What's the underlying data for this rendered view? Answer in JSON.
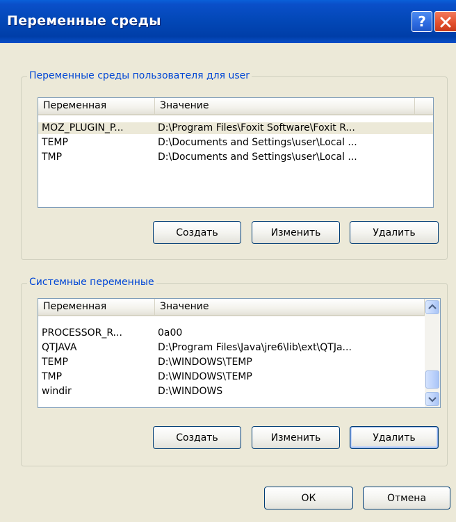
{
  "window": {
    "title": "Переменные среды"
  },
  "title_buttons": {
    "help_label": "?"
  },
  "user_group": {
    "legend": "Переменные среды пользователя для user",
    "columns": [
      "Переменная",
      "Значение"
    ],
    "rows": [
      {
        "name": "MOZ_PLUGIN_P...",
        "value": "D:\\Program Files\\Foxit Software\\Foxit R..."
      },
      {
        "name": "TEMP",
        "value": "D:\\Documents and Settings\\user\\Local ..."
      },
      {
        "name": "TMP",
        "value": "D:\\Documents and Settings\\user\\Local ..."
      }
    ],
    "buttons": {
      "new": "Создать",
      "edit": "Изменить",
      "delete": "Удалить"
    }
  },
  "system_group": {
    "legend": "Системные переменные",
    "columns": [
      "Переменная",
      "Значение"
    ],
    "rows": [
      {
        "name": "PROCESSOR_R...",
        "value": "0a00"
      },
      {
        "name": "QTJAVA",
        "value": "D:\\Program Files\\Java\\jre6\\lib\\ext\\QTJa..."
      },
      {
        "name": "TEMP",
        "value": "D:\\WINDOWS\\TEMP"
      },
      {
        "name": "TMP",
        "value": "D:\\WINDOWS\\TEMP"
      },
      {
        "name": "windir",
        "value": "D:\\WINDOWS"
      }
    ],
    "buttons": {
      "new": "Создать",
      "edit": "Изменить",
      "delete": "Удалить"
    }
  },
  "footer": {
    "ok": "ОК",
    "cancel": "Отмена"
  },
  "colors": {
    "titlebar": "#0348b8",
    "dialog_bg": "#ece9d8",
    "legend_text": "#0046d5",
    "list_border": "#7f9db9"
  },
  "icons": {
    "help": "question-mark-icon",
    "close": "close-x-icon",
    "scroll_up": "chevron-up-icon",
    "scroll_down": "chevron-down-icon"
  }
}
